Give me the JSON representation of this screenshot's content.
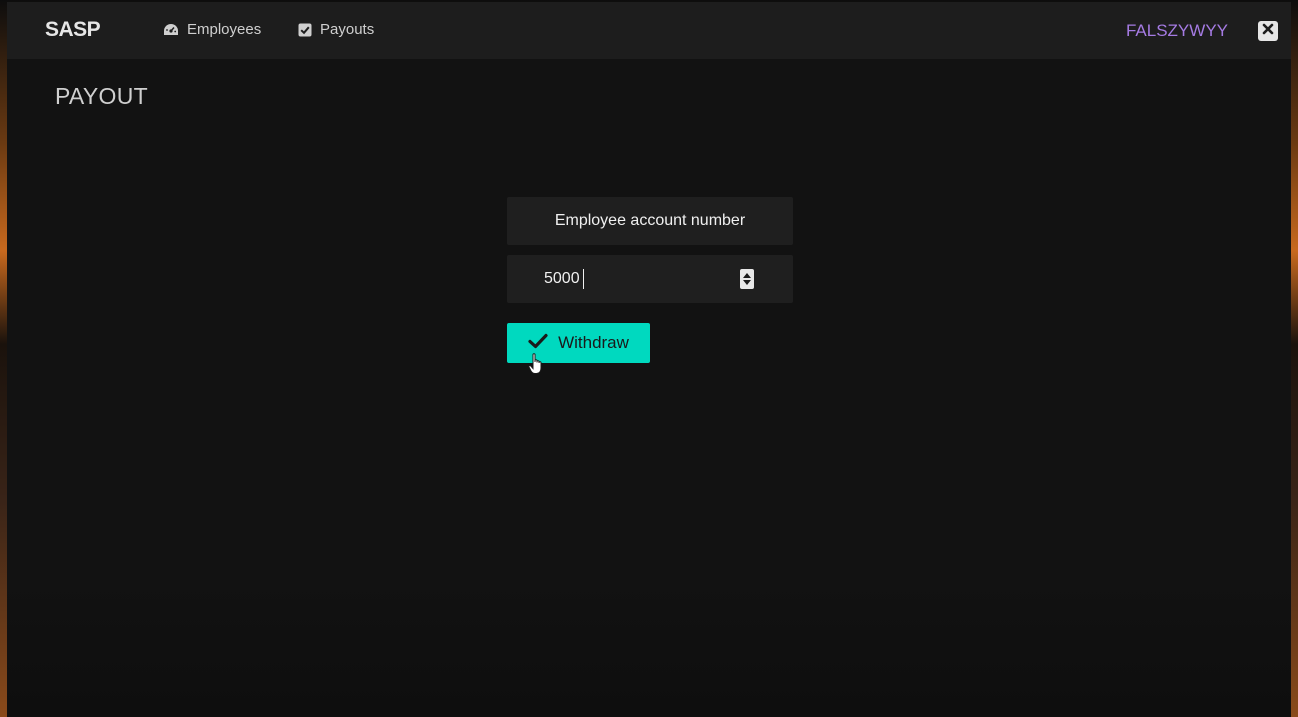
{
  "app": {
    "brand": "SASP",
    "nav": [
      {
        "label": "Employees",
        "icon": "dashboard-icon"
      },
      {
        "label": "Payouts",
        "icon": "checkbox-icon"
      }
    ],
    "username": "FALSZYWYY",
    "close_icon": "close-icon"
  },
  "page": {
    "title": "PAYOUT"
  },
  "form": {
    "label": "Employee account number",
    "amount_value": "5000",
    "withdraw_label": "Withdraw"
  },
  "colors": {
    "accent": "#00d9bf",
    "username": "#a57be3",
    "background": "#121212",
    "topbar": "#1d1d1d"
  }
}
